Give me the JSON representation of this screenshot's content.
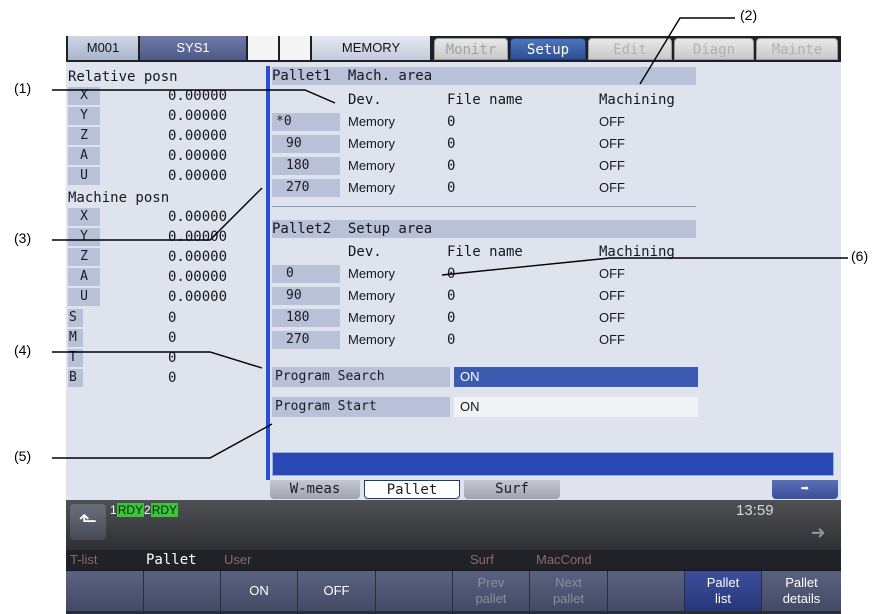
{
  "topbar": {
    "program": "M001",
    "system": "SYS1",
    "mode": "MEMORY",
    "tabs": [
      "Monitr",
      "Setup",
      "Edit",
      "Diagn",
      "Mainte"
    ],
    "active_tab": "Setup"
  },
  "relative": {
    "title": "Relative posn",
    "axes": [
      {
        "axis": "X",
        "value": "0.00000"
      },
      {
        "axis": "Y",
        "value": "0.00000"
      },
      {
        "axis": "Z",
        "value": "0.00000"
      },
      {
        "axis": "A",
        "value": "0.00000"
      },
      {
        "axis": "U",
        "value": "0.00000"
      }
    ]
  },
  "machine": {
    "title": "Machine posn",
    "axes": [
      {
        "axis": "X",
        "value": "0.00000"
      },
      {
        "axis": "Y",
        "value": "0.00000"
      },
      {
        "axis": "Z",
        "value": "0.00000"
      },
      {
        "axis": "A",
        "value": "0.00000"
      },
      {
        "axis": "U",
        "value": "0.00000"
      }
    ]
  },
  "codes": [
    {
      "code": "S",
      "value": "0"
    },
    {
      "code": "M",
      "value": "0"
    },
    {
      "code": "T",
      "value": "0"
    },
    {
      "code": "B",
      "value": "0"
    }
  ],
  "pallet1": {
    "title": "Pallet1  Mach. area",
    "columns": {
      "dev": "Dev.",
      "file": "File name",
      "machining": "Machining"
    },
    "rows": [
      {
        "angle": "*0",
        "dev": "Memory",
        "file": "0",
        "machining": "OFF"
      },
      {
        "angle": "90",
        "dev": "Memory",
        "file": "0",
        "machining": "OFF"
      },
      {
        "angle": "180",
        "dev": "Memory",
        "file": "0",
        "machining": "OFF"
      },
      {
        "angle": "270",
        "dev": "Memory",
        "file": "0",
        "machining": "OFF"
      }
    ]
  },
  "pallet2": {
    "title": "Pallet2  Setup area",
    "columns": {
      "dev": "Dev.",
      "file": "File name",
      "machining": "Machining"
    },
    "rows": [
      {
        "angle": "0",
        "dev": "Memory",
        "file": "0",
        "machining": "OFF"
      },
      {
        "angle": "90",
        "dev": "Memory",
        "file": "0",
        "machining": "OFF"
      },
      {
        "angle": "180",
        "dev": "Memory",
        "file": "0",
        "machining": "OFF"
      },
      {
        "angle": "270",
        "dev": "Memory",
        "file": "0",
        "machining": "OFF"
      }
    ]
  },
  "program_search": {
    "label": "Program Search",
    "value": "ON"
  },
  "program_start": {
    "label": "Program Start",
    "value": "ON"
  },
  "subtabs": [
    "W-meas",
    "Pallet",
    "Surf"
  ],
  "active_subtab": "Pallet",
  "status": {
    "ch1_num": "1",
    "ch1_state": "RDY",
    "ch2_num": "2",
    "ch2_state": "RDY",
    "clock": "13:59"
  },
  "menu_labels": [
    "T-list",
    "Pallet",
    "User",
    "Surf",
    "MacCond"
  ],
  "function_keys": [
    "",
    "",
    "ON",
    "OFF",
    "",
    "Prev pallet",
    "Next pallet",
    "",
    "Pallet list",
    "Pallet details"
  ],
  "callouts": [
    "(1)",
    "(2)",
    "(3)",
    "(4)",
    "(5)",
    "(6)"
  ],
  "colors": {
    "accent": "#2d4f96",
    "screen_bg": "#dfe3ee",
    "rdy_green": "#3cc43c"
  }
}
